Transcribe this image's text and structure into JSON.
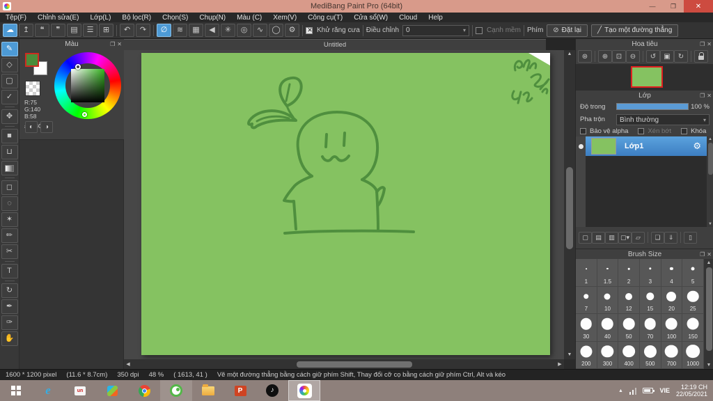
{
  "window": {
    "title": "MediBang Paint Pro (64bit)",
    "minimize": "—",
    "maximize": "❐",
    "close": "✕"
  },
  "menu": {
    "items": [
      "Tệp(F)",
      "Chỉnh sửa(E)",
      "Lớp(L)",
      "Bộ lọc(R)",
      "Chọn(S)",
      "Chụp(N)",
      "Màu (C)",
      "Xem(V)",
      "Công cụ(T)",
      "Cửa sổ(W)",
      "Cloud",
      "Help"
    ]
  },
  "toolbar": {
    "antialias": "Khử răng cưa",
    "adjust": "Điều chỉnh",
    "adjust_value": "0",
    "soft_edge": "Cạnh mềm",
    "key": "Phím",
    "reset": "Đặt lại",
    "reset_glyph": "⊘",
    "make_line": "Tạo một đường thẳng",
    "make_line_glyph": "╱"
  },
  "icons": {
    "toolbar_main": [
      {
        "name": "cloud-sync-icon",
        "glyph": "☁",
        "selected": true
      },
      {
        "name": "share-icon",
        "glyph": "↥"
      },
      {
        "name": "comment-icon",
        "glyph": "❝"
      },
      {
        "name": "comment-panel-icon",
        "glyph": "❞"
      },
      {
        "name": "document-icon",
        "glyph": "▤"
      },
      {
        "name": "material-list-icon",
        "glyph": "☰"
      },
      {
        "name": "grid-add-icon",
        "glyph": "⊞"
      }
    ],
    "history": [
      {
        "name": "undo-icon",
        "glyph": "↶"
      },
      {
        "name": "redo-icon",
        "glyph": "↷"
      }
    ],
    "symmetry": [
      {
        "name": "no-symmetry-icon",
        "glyph": "∅",
        "selected": true
      },
      {
        "name": "parallel-brush-icon",
        "glyph": "≋"
      },
      {
        "name": "crosshatch-brush-icon",
        "glyph": "▦"
      },
      {
        "name": "mirror-brush-icon",
        "glyph": "◀"
      },
      {
        "name": "radial-brush-icon",
        "glyph": "✳"
      },
      {
        "name": "concentric-brush-icon",
        "glyph": "◎"
      },
      {
        "name": "curve-brush-icon",
        "glyph": "∿"
      },
      {
        "name": "circle-brush-icon",
        "glyph": "◯"
      },
      {
        "name": "brush-settings-icon",
        "glyph": "⚙"
      }
    ],
    "left_tools": [
      {
        "name": "brush-tool",
        "glyph": "✎",
        "selected": true
      },
      {
        "name": "eraser-tool",
        "glyph": "◇"
      },
      {
        "name": "shape-tool",
        "glyph": "▢"
      },
      {
        "name": "polyline-tool",
        "glyph": "✓",
        "sep": true
      },
      {
        "name": "move-tool",
        "glyph": "✥",
        "sep": true
      },
      {
        "name": "fill-rect-tool",
        "glyph": "■"
      },
      {
        "name": "bucket-tool",
        "glyph": "⊔"
      },
      {
        "name": "gradient-tool",
        "css": "grad-ic",
        "sep": true
      },
      {
        "name": "select-tool",
        "glyph": "◻"
      },
      {
        "name": "lasso-tool",
        "glyph": "◌"
      },
      {
        "name": "magic-wand-tool",
        "glyph": "✶"
      },
      {
        "name": "select-pen-tool",
        "glyph": "✏"
      },
      {
        "name": "select-eraser-tool",
        "glyph": "✂",
        "sep": true
      },
      {
        "name": "text-tool",
        "glyph": "T",
        "sep": true
      },
      {
        "name": "rotate-view-tool",
        "glyph": "↻"
      },
      {
        "name": "eyedropper-tool",
        "glyph": "✒"
      },
      {
        "name": "divide-tool",
        "glyph": "✑"
      },
      {
        "name": "hand-tool",
        "glyph": "✋"
      }
    ],
    "navigator": [
      {
        "name": "nav-zoom-tool-icon",
        "glyph": "⊛",
        "sep": true
      },
      {
        "name": "nav-zoom-in-icon",
        "glyph": "⊕"
      },
      {
        "name": "nav-fit-icon",
        "glyph": "⊡"
      },
      {
        "name": "nav-zoom-out-icon",
        "glyph": "⊖",
        "sep": true
      },
      {
        "name": "nav-rotate-ccw-icon",
        "glyph": "↺"
      },
      {
        "name": "nav-reset-rotation-icon",
        "glyph": "▣"
      },
      {
        "name": "nav-rotate-cw-icon",
        "glyph": "↻",
        "sep": true
      },
      {
        "name": "nav-lock-icon",
        "css": "lock-ic"
      }
    ],
    "layer_buttons": [
      {
        "name": "new-layer-button",
        "glyph": "▢"
      },
      {
        "name": "new-8bit-layer-button",
        "glyph": "▤"
      },
      {
        "name": "new-1bit-layer-button",
        "glyph": "▥"
      },
      {
        "name": "add-layer-menu-button",
        "glyph": "▢▾"
      },
      {
        "name": "layer-folder-button",
        "glyph": "▱",
        "sep": true
      },
      {
        "name": "duplicate-layer-button",
        "glyph": "❏"
      },
      {
        "name": "merge-layer-button",
        "glyph": "⇓",
        "sep": true
      },
      {
        "name": "delete-layer-button",
        "glyph": "▯"
      }
    ],
    "palette": [
      {
        "name": "palette-icon",
        "glyph": "◐"
      },
      {
        "name": "palette-add-icon",
        "glyph": "◑"
      }
    ]
  },
  "color_panel": {
    "title": "Màu",
    "r": "R:75",
    "g": "G:140",
    "b": "B:58",
    "hex": "#4B8C3A"
  },
  "document": {
    "tab": "Untitled"
  },
  "navigator": {
    "title": "Hoa tiêu"
  },
  "layers": {
    "title": "Lớp",
    "opacity_label": "Độ trong",
    "opacity_value": "100 %",
    "blend_label": "Pha trộn",
    "blend_value": "Bình thường",
    "protect_alpha": "Bảo vệ alpha",
    "clipping": "Xén bớt",
    "lock": "Khóa",
    "layer_name": "Lớp1",
    "gear_glyph": "⚙"
  },
  "brush": {
    "title": "Brush Size",
    "sizes": [
      1,
      1.5,
      2,
      3,
      4,
      5,
      7,
      10,
      12,
      15,
      20,
      25,
      30,
      40,
      50,
      70,
      100,
      150,
      200,
      300,
      400,
      500,
      700,
      1000
    ]
  },
  "status": {
    "pixels": "1600 * 1200 pixel",
    "cm": "(11.6 * 8.7cm)",
    "dpi": "350 dpi",
    "zoom": "48 %",
    "coords": "( 1613, 41 )",
    "hint": "Vẽ một đường thẳng bằng cách giữ phím Shift, Thay đổi cỡ cọ bằng cách giữ phím Ctrl, Alt và kéo"
  },
  "taskbar": {
    "expand_glyph": "▲",
    "language": "VIE",
    "time": "12:19 CH",
    "date": "22/05/2021",
    "ie_glyph": "e",
    "unikey_glyph": "un",
    "powerpoint_glyph": "P",
    "tiktok_glyph": "♪"
  },
  "colors": {
    "titlebar": "#d89a8a",
    "accent_blue": "#4d9ad5",
    "canvas_green": "#85c261",
    "stroke_green": "#4F8F3E",
    "picked_color": "#4B8C3A",
    "selected_layer": "#4a90d2"
  }
}
